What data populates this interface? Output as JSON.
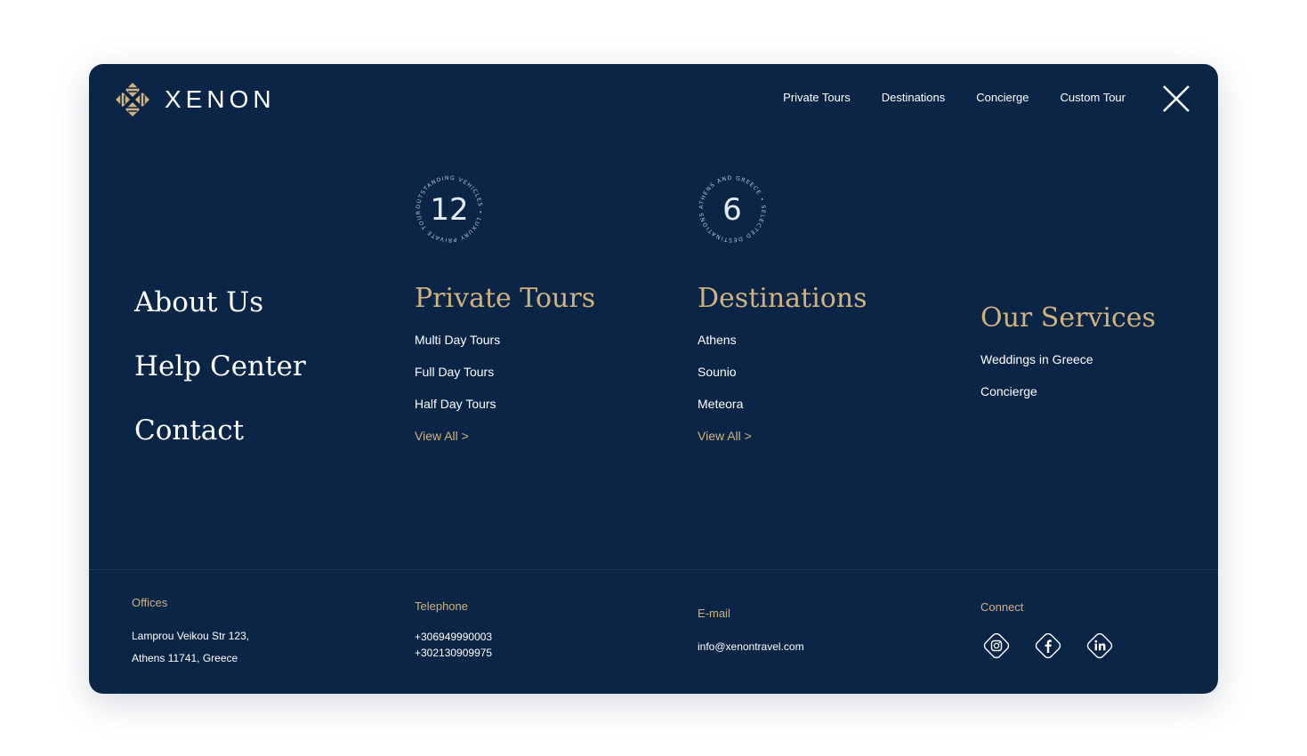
{
  "brand": {
    "name": "XENON",
    "accent": "#d0b27e",
    "background": "#0a2546"
  },
  "topnav": {
    "items": [
      "Private Tours",
      "Destinations",
      "Concierge",
      "Custom Tour"
    ],
    "close_icon": "close-icon"
  },
  "badges": [
    {
      "number": "12",
      "ring_text": "OUTSTANDING VEHICLES • LUXURY PRIVATE TOURS IN •"
    },
    {
      "number": "6",
      "ring_text": "ATHENS AND GREECE • SELECTED DESTINATIONS •"
    }
  ],
  "left_links": [
    "About Us",
    "Help Center",
    "Contact"
  ],
  "private_tours": {
    "title": "Private Tours",
    "items": [
      "Multi Day Tours",
      "Full Day Tours",
      "Half Day Tours"
    ],
    "view_all": "View All >"
  },
  "destinations": {
    "title": "Destinations",
    "items": [
      "Athens",
      "Sounio",
      "Meteora"
    ],
    "view_all": "View All >"
  },
  "services": {
    "title": "Our Services",
    "items": [
      "Weddings in Greece",
      "Concierge"
    ]
  },
  "footer": {
    "offices": {
      "label": "Offices",
      "lines": [
        "Lamprou Veikou Str 123,",
        "Athens 11741, Greece"
      ]
    },
    "telephone": {
      "label": "Telephone",
      "lines": [
        "+306949990003",
        "+302130909975"
      ]
    },
    "email": {
      "label": "E-mail",
      "value": "info@xenontravel.com"
    },
    "connect": {
      "label": "Connect",
      "icons": [
        "instagram-icon",
        "facebook-icon",
        "linkedin-icon"
      ]
    }
  }
}
